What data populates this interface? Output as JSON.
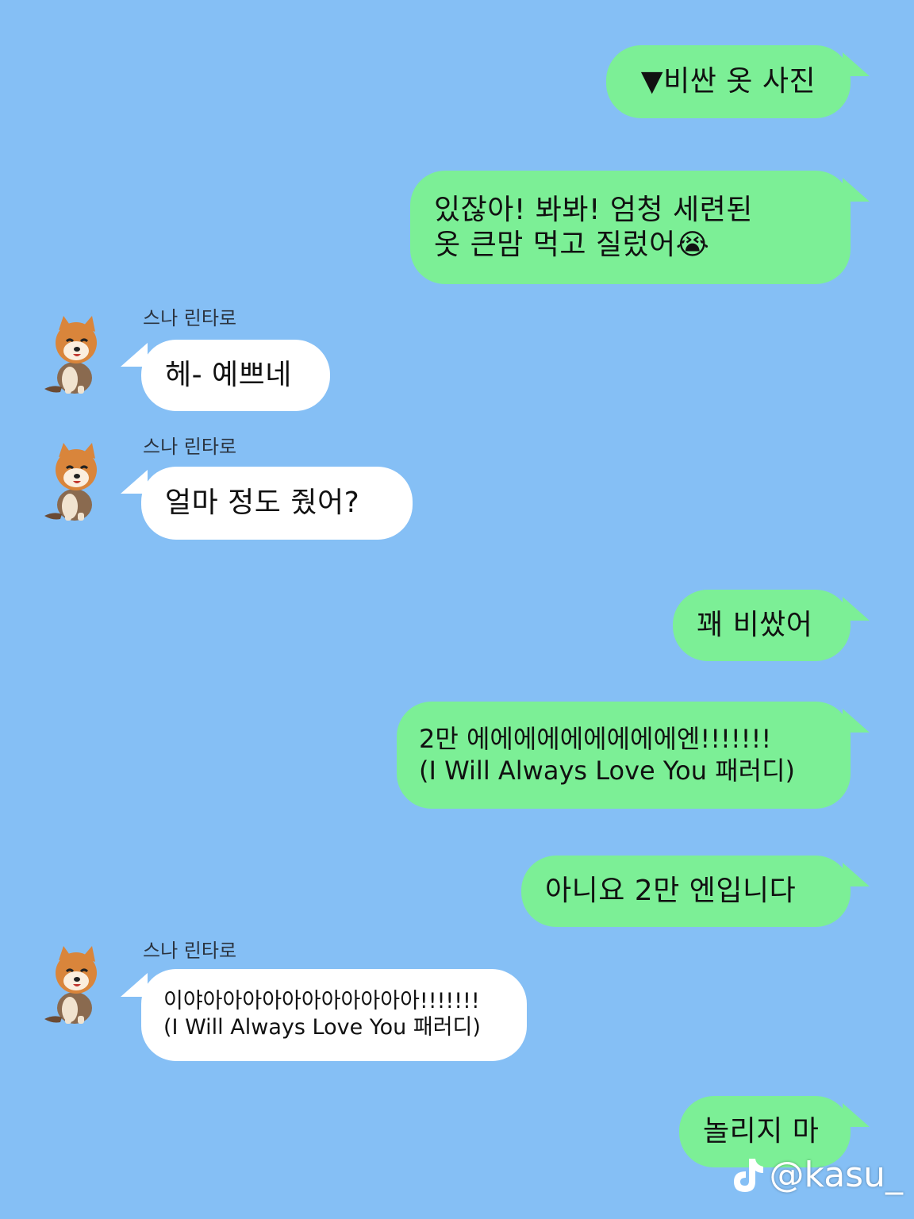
{
  "chat": {
    "partner_name": "스나 린타로",
    "messages": [
      {
        "from": "me",
        "lines": [
          "▼비싼 옷 사진"
        ]
      },
      {
        "from": "me",
        "lines": [
          "있잖아! 봐봐! 엄청 세련된",
          "옷 큰맘 먹고 질렀어😭"
        ]
      },
      {
        "from": "them",
        "lines": [
          "헤- 예쁘네"
        ]
      },
      {
        "from": "them",
        "lines": [
          "얼마 정도 줬어?"
        ]
      },
      {
        "from": "me",
        "lines": [
          "꽤 비쌌어"
        ]
      },
      {
        "from": "me",
        "lines": [
          "2만 에에에에에에에에에엔!!!!!!!",
          "(I Will Always Love You 패러디)"
        ]
      },
      {
        "from": "me",
        "lines": [
          "아니요 2만 엔입니다"
        ]
      },
      {
        "from": "them",
        "lines": [
          "이야아아아아아아아아아아아!!!!!!!",
          "(I Will Always Love You 패러디)"
        ]
      },
      {
        "from": "me",
        "lines": [
          "놀리지 마"
        ]
      }
    ]
  },
  "watermark": {
    "icon": "tiktok-icon",
    "text": "@kasu_"
  },
  "colors": {
    "background": "#85bff5",
    "my_bubble": "#7cef96",
    "their_bubble": "#ffffff"
  }
}
